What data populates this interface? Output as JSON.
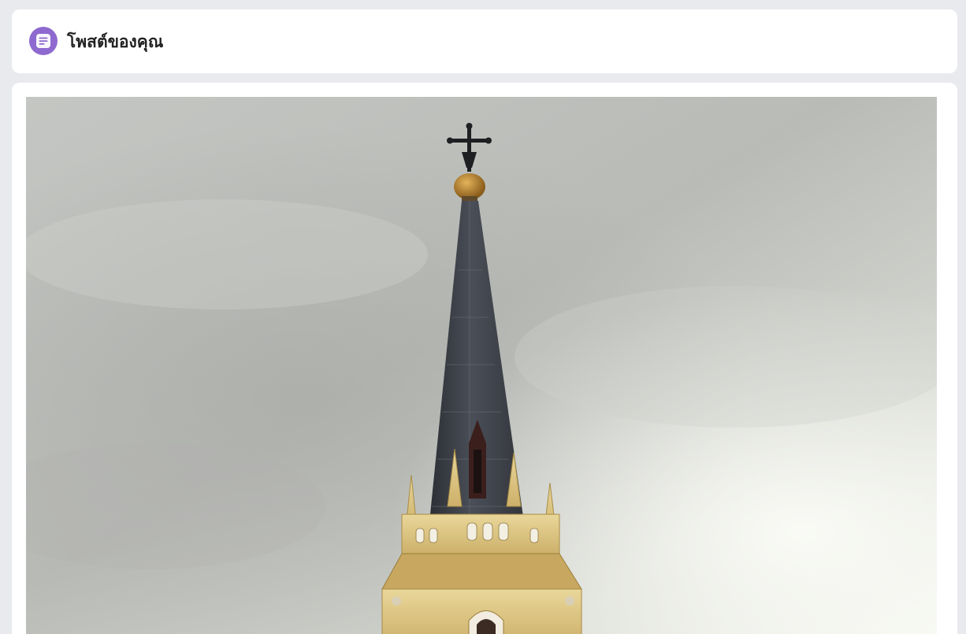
{
  "header": {
    "title": "โพสต์ของคุณ",
    "icon": "post-list-icon",
    "icon_color": "#8e69cf"
  },
  "post": {
    "image": "church-spire-photo"
  }
}
